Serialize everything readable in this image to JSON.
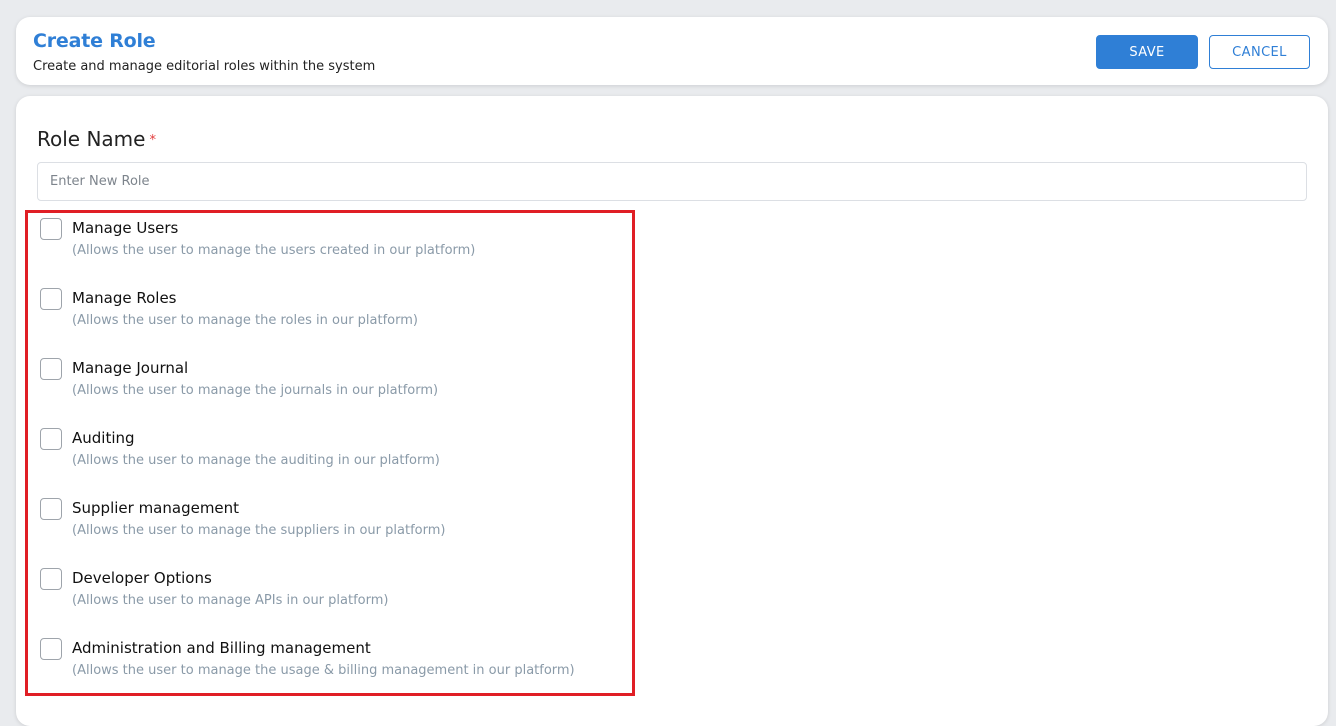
{
  "header": {
    "title": "Create Role",
    "subtitle": "Create and manage editorial roles within the system",
    "save_label": "SAVE",
    "cancel_label": "CANCEL"
  },
  "form": {
    "role_label": "Role Name",
    "required_marker": "*",
    "role_placeholder": "Enter New Role",
    "role_value": ""
  },
  "permissions": [
    {
      "title": "Manage Users",
      "description": "(Allows the user to manage the users created in our platform)",
      "checked": false
    },
    {
      "title": "Manage Roles",
      "description": "(Allows the user to manage the roles in our platform)",
      "checked": false
    },
    {
      "title": "Manage Journal",
      "description": "(Allows the user to manage the journals in our platform)",
      "checked": false
    },
    {
      "title": "Auditing",
      "description": "(Allows the user to manage the auditing in our platform)",
      "checked": false
    },
    {
      "title": "Supplier management",
      "description": "(Allows the user to manage the suppliers in our platform)",
      "checked": false
    },
    {
      "title": "Developer Options",
      "description": "(Allows the user to manage APIs in our platform)",
      "checked": false
    },
    {
      "title": "Administration and Billing management",
      "description": "(Allows the user to manage the usage & billing management in our platform)",
      "checked": false
    }
  ],
  "colors": {
    "accent": "#2f7fd6",
    "highlight": "#e01e25",
    "required": "#e23b3b",
    "description_text": "#8a9aa8"
  }
}
